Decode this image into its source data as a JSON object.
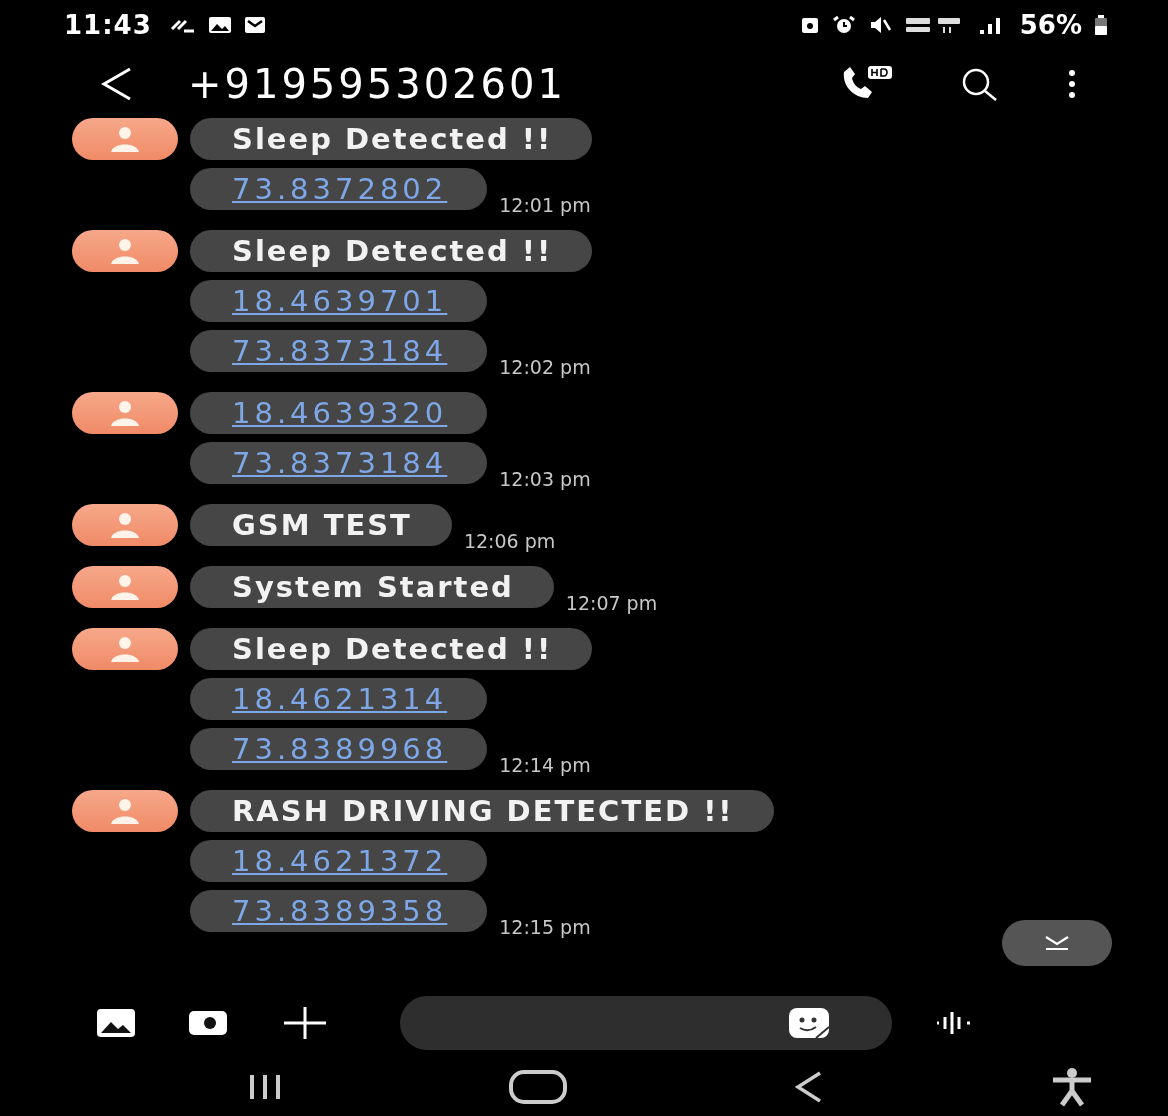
{
  "status_bar": {
    "time": "11:43",
    "battery": "56%"
  },
  "header": {
    "title": "+919595302601"
  },
  "messages": [
    {
      "bubbles": [
        {
          "kind": "text",
          "text": "Sleep Detected !!"
        },
        {
          "kind": "link",
          "text": "73.8372802"
        }
      ],
      "time": "12:01 pm"
    },
    {
      "bubbles": [
        {
          "kind": "text",
          "text": "Sleep Detected !!"
        },
        {
          "kind": "link",
          "text": "18.4639701"
        },
        {
          "kind": "link",
          "text": "73.8373184"
        }
      ],
      "time": "12:02 pm"
    },
    {
      "bubbles": [
        {
          "kind": "link",
          "text": "18.4639320"
        },
        {
          "kind": "link",
          "text": "73.8373184"
        }
      ],
      "time": "12:03 pm"
    },
    {
      "bubbles": [
        {
          "kind": "text",
          "text": "GSM TEST"
        }
      ],
      "time": "12:06 pm"
    },
    {
      "bubbles": [
        {
          "kind": "text",
          "text": "System Started"
        }
      ],
      "time": "12:07 pm"
    },
    {
      "bubbles": [
        {
          "kind": "text",
          "text": "Sleep Detected !!"
        },
        {
          "kind": "link",
          "text": "18.4621314"
        },
        {
          "kind": "link",
          "text": "73.8389968"
        }
      ],
      "time": "12:14 pm"
    },
    {
      "bubbles": [
        {
          "kind": "text",
          "text": "RASH DRIVING DETECTED !!"
        },
        {
          "kind": "link",
          "text": "18.4621372"
        },
        {
          "kind": "link",
          "text": "73.8389358"
        }
      ],
      "time": "12:15 pm"
    }
  ]
}
